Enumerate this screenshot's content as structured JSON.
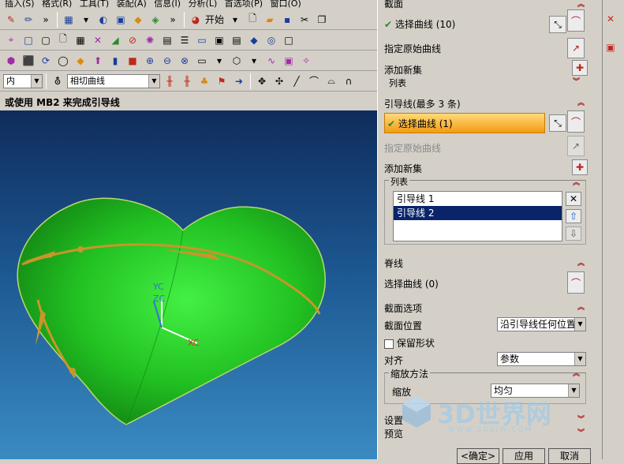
{
  "menubar": {
    "items": [
      "插入(S)",
      "格式(R)",
      "工具(T)",
      "装配(A)",
      "信息(I)",
      "分析(L)",
      "首选项(P)",
      "窗口(O)"
    ]
  },
  "toolbar": {
    "start_label": "开始",
    "orient_value": "内",
    "curve_filter_value": "相切曲线"
  },
  "status": {
    "text": "或使用 MB2 来完成引导线"
  },
  "viewport": {
    "axis_labels": {
      "yc": "YC",
      "zc": "ZC",
      "xc": "XC"
    },
    "colors": {
      "heart": "#22c122",
      "guide": "#c8962a",
      "bg_top": "#0f2c5c",
      "bg_bottom": "#3a8bc2"
    }
  },
  "panel": {
    "section1": {
      "title": "截面",
      "select_curve": "选择曲线 (10)",
      "specify_origin": "指定原始曲线",
      "add_new_set": "添加新集",
      "list": "列表"
    },
    "guides": {
      "title": "引导线(最多 3 条)",
      "select_curve": "选择曲线 (1)",
      "specify_origin": "指定原始曲线",
      "add_new_set": "添加新集",
      "list_label": "列表",
      "list_items": [
        "引导线 1",
        "引导线 2"
      ],
      "selected_index": 1
    },
    "spine": {
      "title": "脊线",
      "select_curve": "选择曲线 (0)"
    },
    "section_options": {
      "title": "截面选项",
      "position_label": "截面位置",
      "position_value": "沿引导线任何位置",
      "keep_shape": "保留形状",
      "align_label": "对齐",
      "align_value": "参数",
      "scale_group": "缩放方法",
      "scale_label": "缩放",
      "scale_value": "均匀"
    },
    "settings": "设置",
    "preview": "预览",
    "buttons": {
      "ok": "<确定>",
      "apply": "应用",
      "cancel": "取消"
    }
  },
  "watermark": {
    "text": "3D世界网",
    "url": "WWW.3DSJW.COM"
  }
}
